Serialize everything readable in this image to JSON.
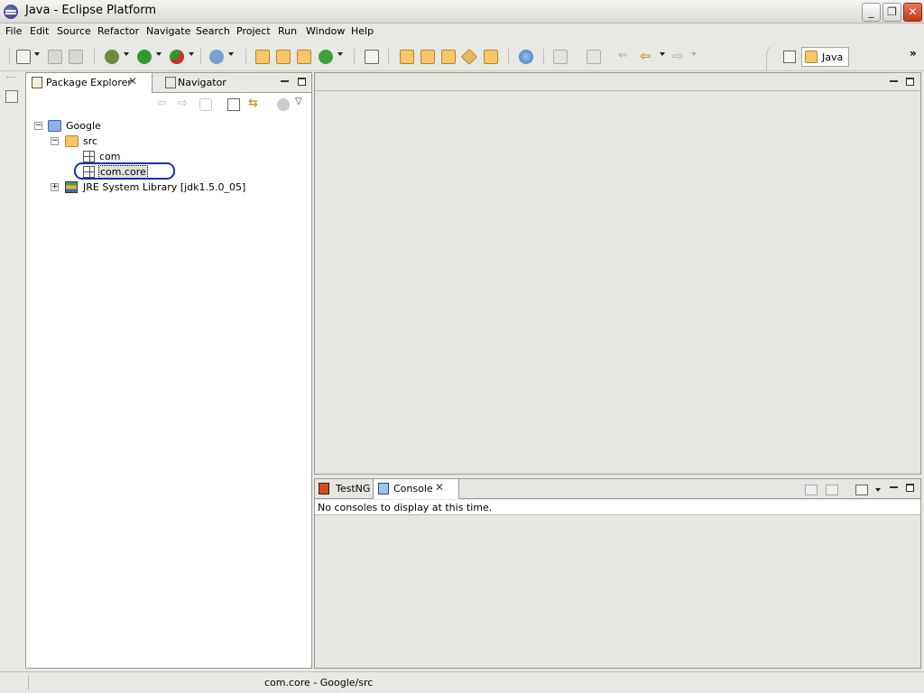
{
  "window": {
    "title": "Java - Eclipse Platform",
    "minimize": "_",
    "maximize": "❐",
    "close": "✕"
  },
  "menu": [
    "File",
    "Edit",
    "Source",
    "Refactor",
    "Navigate",
    "Search",
    "Project",
    "Run",
    "Window",
    "Help"
  ],
  "toolbar": {
    "icons": [
      "new-wizard-icon",
      "save-icon",
      "print-icon",
      "debug-icon",
      "run-icon",
      "external-tools-icon",
      "search-icon",
      "new-java-project-icon",
      "new-package-icon",
      "new-class-icon",
      "new-other-icon",
      "open-task-icon",
      "open-type-icon",
      "open-type-hierarchy-icon",
      "open-resource-icon",
      "toggle-mark-icon",
      "open-file-icon",
      "globe-icon",
      "next-annotation-icon",
      "prev-annotation-icon",
      "last-edit-icon",
      "back-icon",
      "forward-icon"
    ],
    "perspective": "Java",
    "overflow": "»"
  },
  "package_explorer": {
    "tabs": [
      {
        "label": "Package Explorer",
        "close": "✕"
      },
      {
        "label": "Navigator"
      }
    ],
    "tree": {
      "project": "Google",
      "src": "src",
      "packages": [
        "com",
        "com.core"
      ],
      "library": "JRE System Library [jdk1.5.0_05]"
    },
    "expander_open": "−",
    "expander_closed": "+"
  },
  "console": {
    "tabs": [
      {
        "label": "TestNG"
      },
      {
        "label": "Console",
        "close": "✕"
      }
    ],
    "message": "No consoles to display at this time."
  },
  "status": {
    "text": "com.core - Google/src"
  },
  "colors": {
    "highlight_ring": "#1b2fb8",
    "background": "#e8e8e4"
  }
}
